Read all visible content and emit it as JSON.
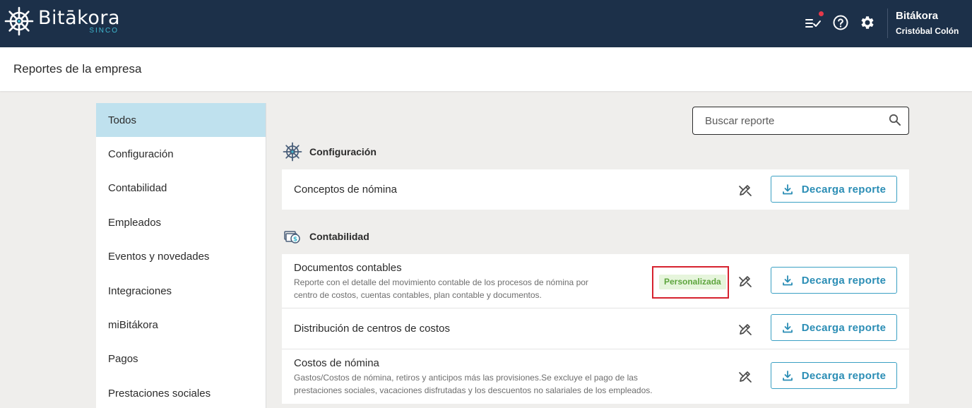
{
  "header": {
    "logo_name": "Bitākora",
    "logo_sub": "SINCO",
    "user_app": "Bitákora",
    "user_name": "Cristóbal Colón",
    "icons": [
      "tasks-icon",
      "help-icon",
      "gear-icon"
    ],
    "notification_dot_color": "#e5394a",
    "bar_color": "#1c3049"
  },
  "page": {
    "title": "Reportes de la empresa"
  },
  "sidebar": {
    "items": [
      {
        "label": "Todos",
        "active": true
      },
      {
        "label": "Configuración"
      },
      {
        "label": "Contabilidad"
      },
      {
        "label": "Empleados"
      },
      {
        "label": "Eventos y novedades"
      },
      {
        "label": "Integraciones"
      },
      {
        "label": "miBitákora"
      },
      {
        "label": "Pagos"
      },
      {
        "label": "Prestaciones sociales"
      }
    ]
  },
  "search": {
    "placeholder": "Buscar reporte",
    "value": ""
  },
  "sections": [
    {
      "title": "Configuración",
      "icon": "wheel-icon",
      "reports": [
        {
          "title": "Conceptos de nómina",
          "button": "Decarga reporte"
        }
      ]
    },
    {
      "title": "Contabilidad",
      "icon": "money-icon",
      "reports": [
        {
          "title": "Documentos contables",
          "description_line1": "Reporte con el detalle del movimiento contable de los procesos de nómina por",
          "description_line2": "centro de costos, cuentas contables, plan contable y documentos.",
          "badge": "Personalizada",
          "button": "Decarga reporte"
        },
        {
          "title": "Distribución de centros de costos",
          "button": "Decarga reporte"
        },
        {
          "title": "Costos de nómina",
          "description_line1": "Gastos/Costos de nómina, retiros y anticipos más las provisiones.Se excluye el pago de las",
          "description_line2": "prestaciones sociales, vacaciones disfrutadas y los descuentos no salariales de los empleados.",
          "button": "Decarga reporte"
        }
      ]
    }
  ]
}
